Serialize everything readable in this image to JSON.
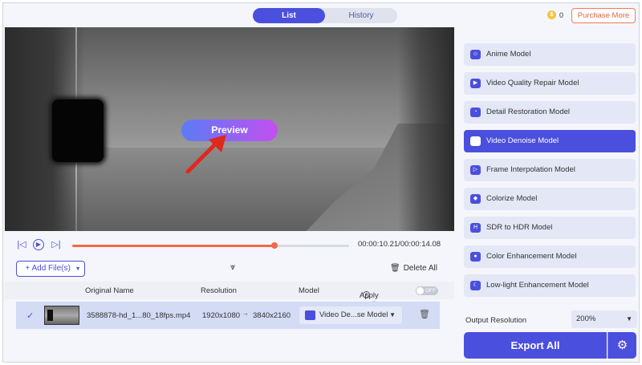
{
  "header": {
    "tabs": [
      {
        "label": "List",
        "active": true
      },
      {
        "label": "History",
        "active": false
      }
    ],
    "coins": "0",
    "purchase_label": "Purchase More"
  },
  "preview": {
    "button_label": "Preview"
  },
  "player": {
    "timecode": "00:00:10.21/00:00:14.08",
    "progress": 0.73
  },
  "toolbar": {
    "add_files_label": "+ Add File(s)",
    "delete_all_label": "Delete All"
  },
  "table": {
    "columns": {
      "original_name": "Original Name",
      "resolution": "Resolution",
      "model": "Model",
      "apply_to_all": "Apply to all"
    },
    "toggle": "OFF",
    "rows": [
      {
        "file_name": "3588878-hd_1...80_18fps.mp4",
        "input_resolution": "1920x1080",
        "arrow": "→",
        "output_resolution": "3840x2160",
        "model": "Video De...se Model"
      }
    ]
  },
  "models": [
    {
      "label": "Anime Model",
      "icon": "anime-icon",
      "active": false
    },
    {
      "label": "Video Quality Repair Model",
      "icon": "video-repair-icon",
      "active": false
    },
    {
      "label": "Detail Restoration Model",
      "icon": "detail-icon",
      "active": false
    },
    {
      "label": "Video Denoise Model",
      "icon": "denoise-icon",
      "active": true
    },
    {
      "label": "Frame Interpolation Model",
      "icon": "frame-icon",
      "active": false
    },
    {
      "label": "Colorize Model",
      "icon": "colorize-icon",
      "active": false
    },
    {
      "label": "SDR to HDR Model",
      "icon": "hdr-icon",
      "active": false
    },
    {
      "label": "Color Enhancement Model",
      "icon": "palette-icon",
      "active": false
    },
    {
      "label": "Low-light Enhancement Model",
      "icon": "moon-icon",
      "active": false
    }
  ],
  "output": {
    "label": "Output Resolution",
    "value": "200%"
  },
  "export_label": "Export All",
  "colors": {
    "accent": "#4b4fdd",
    "progress": "#ef6a45",
    "purchase": "#e0654a"
  }
}
